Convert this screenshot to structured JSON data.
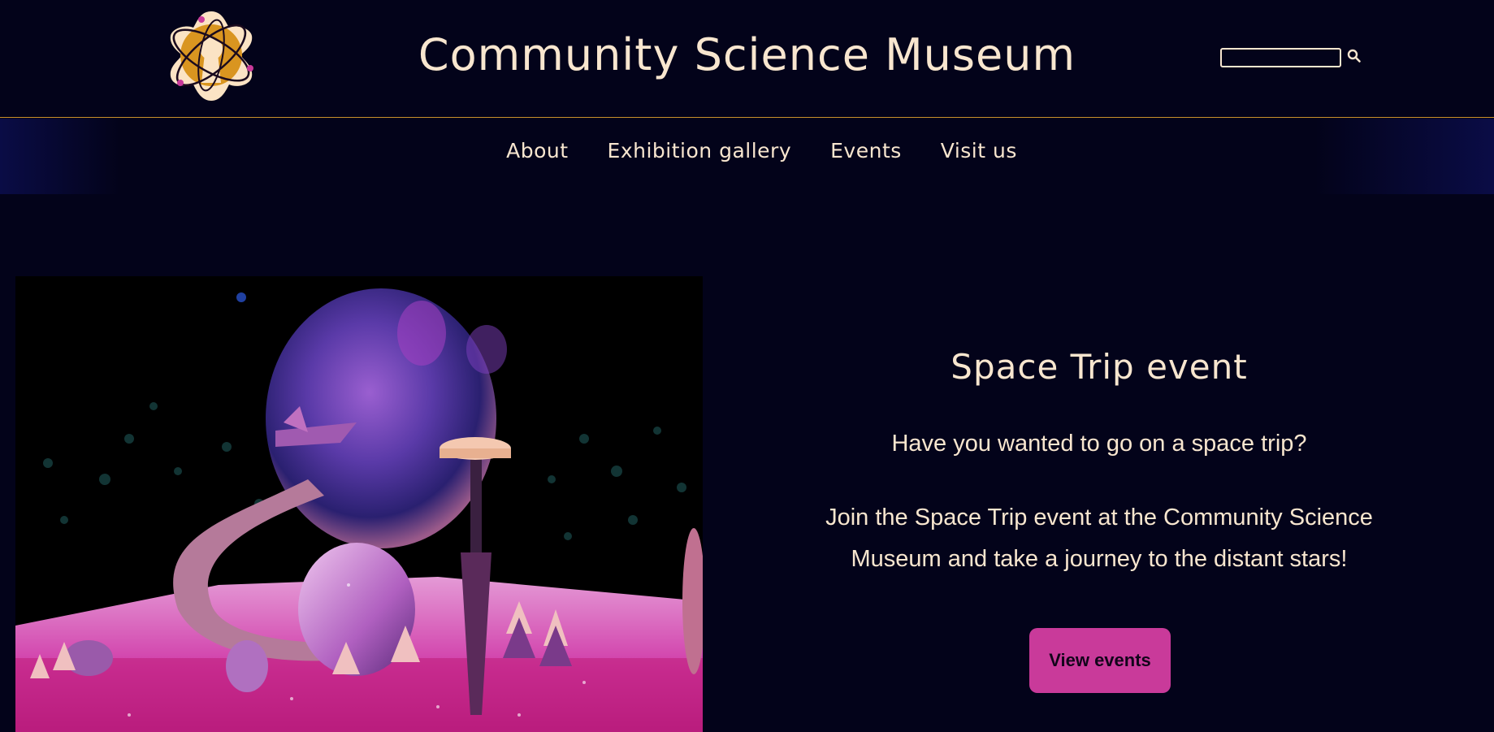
{
  "header": {
    "site_title": "Community Science Museum",
    "logo_icon": "atom-keyhole-logo",
    "search": {
      "placeholder": "",
      "value": "",
      "button_icon": "search-icon"
    }
  },
  "nav": {
    "items": [
      {
        "label": "About"
      },
      {
        "label": "Exhibition gallery"
      },
      {
        "label": "Events"
      },
      {
        "label": "Visit us"
      }
    ]
  },
  "main": {
    "image_subject": "space-theme-park-diorama",
    "event_title": "Space Trip event",
    "question": "Have you wanted to go on a space trip?",
    "description": "Join the Space Trip event at the Community Science Museum and take a journey to the distant stars!",
    "button_label": "View events"
  },
  "colors": {
    "background": "#03031a",
    "text": "#f8e6cf",
    "accent_border": "#c8902a",
    "button": "#c93a9a"
  }
}
